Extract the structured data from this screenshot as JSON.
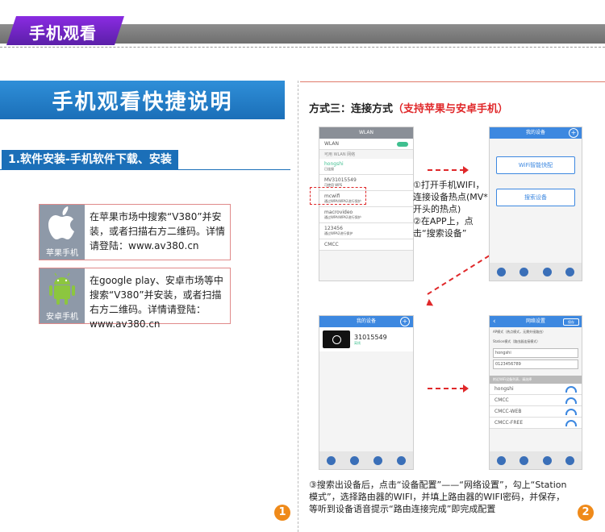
{
  "header": {
    "tab_title": "手机观看"
  },
  "left": {
    "title": "手机观看快捷说明",
    "section_label": "1.软件安装-手机软件下载、安装",
    "apps": [
      {
        "platform": "苹果手机",
        "icon": "apple-icon",
        "text": "在苹果市场中搜索“V380”并安装，或者扫描右方二维码。详情请登陆：www.av380.cn"
      },
      {
        "platform": "安卓手机",
        "icon": "android-icon",
        "text": "在google play、安卓市场等中搜索“V380”并安装，或者扫描右方二维码。详情请登陆：www.av380.cn"
      }
    ],
    "page_number": "1"
  },
  "right": {
    "method_title": "方式三：连接方式",
    "method_highlight": "（支持苹果与安卓手机）",
    "step_one_two": "①打开手机WIFI，连接设备热点(MV*开头的热点)\n②在APP上，点击“搜索设备”",
    "step_three": "③搜索出设备后，点击“设备配置”——“网络设置”，勾上“Station模式”，选择路由器的WIFI，并填上路由器的WIFI密码，并保存，等听到设备语音提示“路由连接完成”即完成配置",
    "page_number": "2"
  },
  "phone1": {
    "title": "WLAN",
    "wlan_label": "WLAN",
    "hint": "可用 WLAN 网络",
    "networks": [
      {
        "name": "hongshi",
        "status": "已连接"
      },
      {
        "name": "MV31015549",
        "status": "可使用 WPS"
      },
      {
        "name": "mcwifi",
        "status": "通过WPA/WPA2进行保护"
      },
      {
        "name": "macrovideo",
        "status": "通过WPA/WPA2进行保护"
      },
      {
        "name": "123456",
        "status": "通过WPA2进行保护"
      },
      {
        "name": "CMCC",
        "status": ""
      }
    ]
  },
  "phone2": {
    "title": "我的设备",
    "button_one": "WiFi智能快配",
    "button_two": "搜索设备"
  },
  "phone3": {
    "title": "我的设备",
    "device_id": "31015549",
    "device_status": "离线"
  },
  "phone4": {
    "title": "网络设置",
    "save": "保存",
    "ap_mode": "AP模式（热点模式，无需外接路由）",
    "station_mode": "Station模式（路由器连接模式）",
    "ssid": "hongshi",
    "password": "0123456789",
    "list_header": "附近WiFi设备列表，请选择",
    "wifi_list": [
      "hongshi",
      "CMCC",
      "CMCC-WEB",
      "CMCC-FREE"
    ]
  },
  "colors": {
    "header_purple": "#6a24c4",
    "title_blue": "#1b6fb8",
    "highlight_red": "#e0282a",
    "badge_orange": "#ef8a1a"
  }
}
